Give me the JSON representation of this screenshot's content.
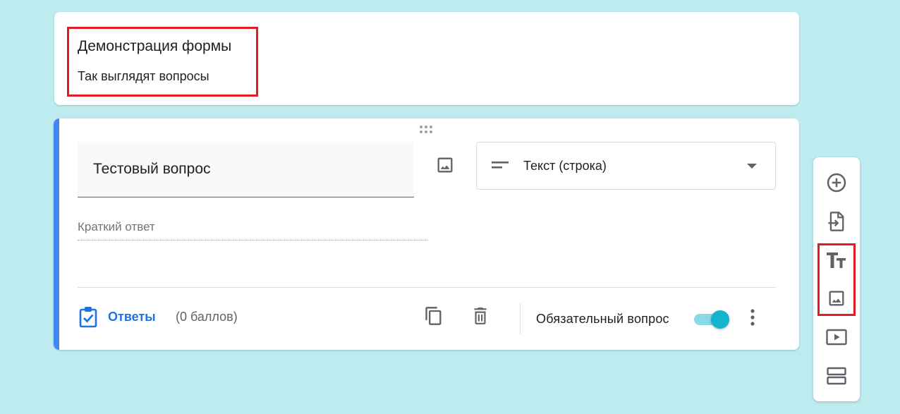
{
  "form": {
    "title": "Демонстрация формы",
    "description": "Так выглядят вопросы"
  },
  "question": {
    "text": "Тестовый вопрос",
    "type_label": "Текст (строка)",
    "answer_placeholder": "Краткий ответ",
    "answers_label": "Ответы",
    "points_label": "(0 баллов)",
    "required_label": "Обязательный вопрос",
    "required": true
  },
  "icons": {
    "drag": "drag-handle-icon",
    "add_image": "image-icon",
    "type": "short-text-icon",
    "caret": "dropdown-arrow-icon",
    "answers": "assignment-check-icon",
    "copy": "copy-icon",
    "delete": "trash-icon",
    "more": "more-vert-icon"
  },
  "toolbar": {
    "items": [
      "add-question",
      "import-questions",
      "add-title-description",
      "add-image",
      "add-video",
      "add-section"
    ]
  },
  "colors": {
    "background": "#bdebf0",
    "accent": "#4285f4",
    "link": "#1a73e8",
    "toggle": "#13b4cf",
    "highlight": "#e31b23"
  }
}
